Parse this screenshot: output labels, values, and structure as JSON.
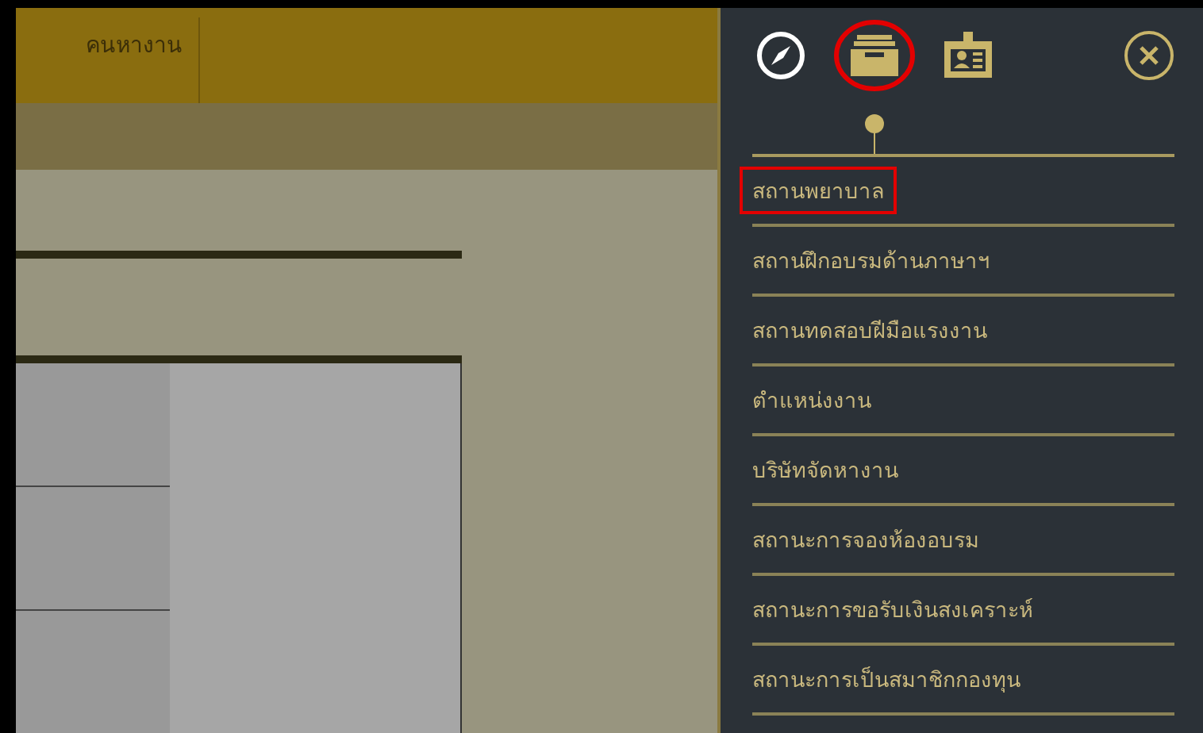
{
  "header": {
    "nav_label": "คนหางาน"
  },
  "side_panel": {
    "tabs": [
      {
        "kind": "compass",
        "selected": false,
        "annotated": false
      },
      {
        "kind": "tray",
        "selected": true,
        "annotated": true
      },
      {
        "kind": "id-card",
        "selected": false,
        "annotated": false
      }
    ],
    "items": [
      {
        "label": "สถานพยาบาล",
        "annotated": true
      },
      {
        "label": "สถานฝึกอบรมด้านภาษาฯ",
        "annotated": false
      },
      {
        "label": "สถานทดสอบฝีมือแรงงาน",
        "annotated": false
      },
      {
        "label": "ตำแหน่งงาน",
        "annotated": false
      },
      {
        "label": "บริษัทจัดหางาน",
        "annotated": false
      },
      {
        "label": "สถานะการจองห้องอบรม",
        "annotated": false
      },
      {
        "label": "สถานะการขอรับเงินสงเคราะห์",
        "annotated": false
      },
      {
        "label": "สถานะการเป็นสมาชิกกองทุน",
        "annotated": false
      }
    ]
  }
}
